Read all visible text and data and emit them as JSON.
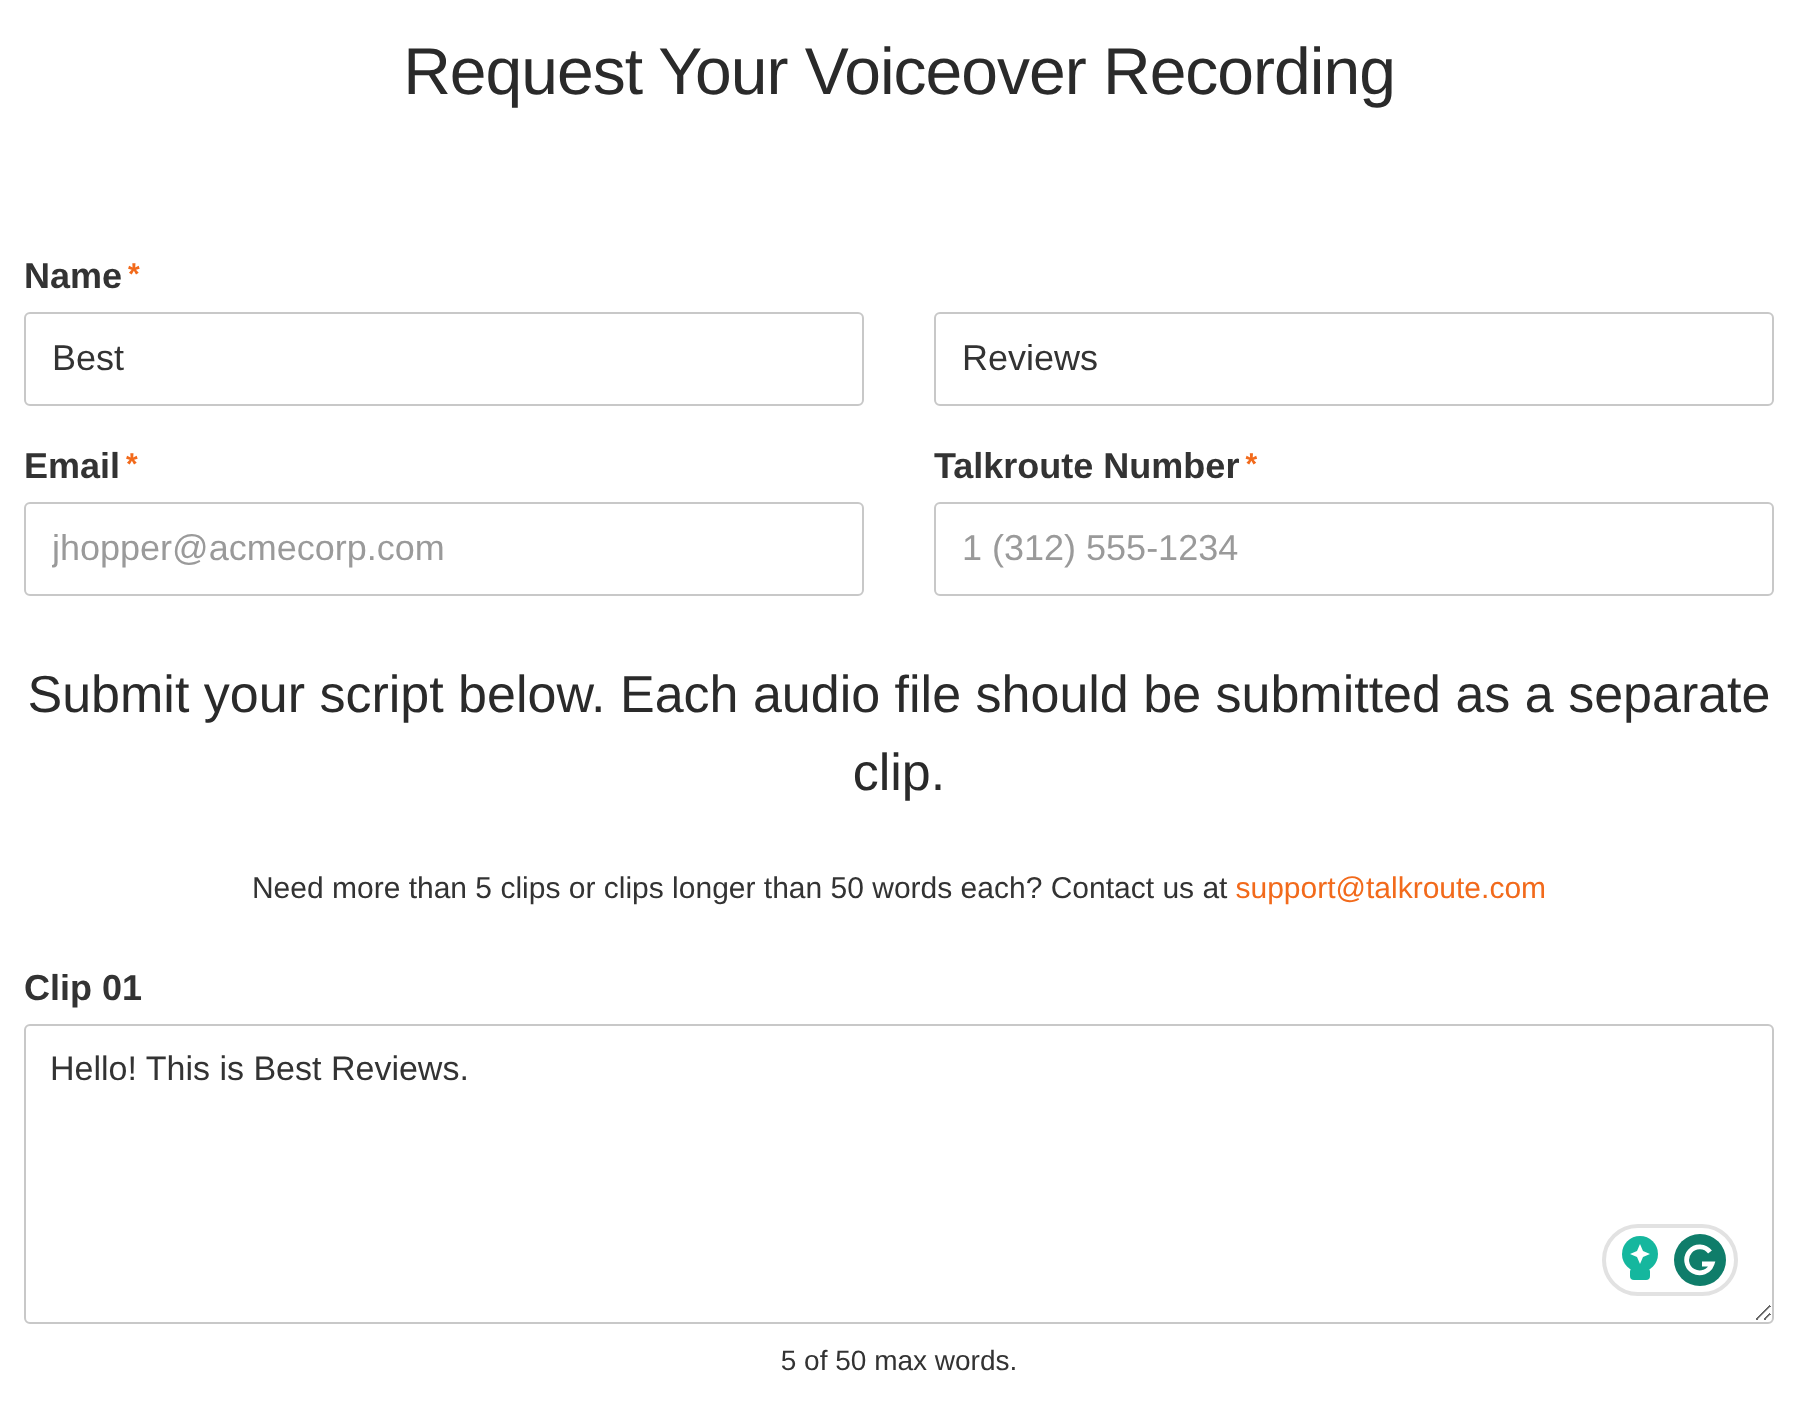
{
  "title": "Request Your Voiceover Recording",
  "rows": [
    {
      "fields": [
        {
          "label": "Name",
          "required_mark": "*",
          "value": "Best"
        },
        {
          "value": "Reviews"
        }
      ]
    },
    {
      "fields": [
        {
          "label": "Email",
          "required_mark": "*",
          "placeholder": "jhopper@acmecorp.com"
        },
        {
          "label": "Talkroute Number",
          "required_mark": "*",
          "placeholder": "1 (312) 555-1234"
        }
      ]
    }
  ],
  "instructions": "Submit your script below. Each audio file should be submitted as a separate clip.",
  "note": {
    "text": "Need more than 5 clips or clips longer than 50 words each? Contact us at",
    "link": "support@talkroute.com"
  },
  "clips": [
    {
      "label": "Clip 01",
      "value": "Hello! This is Best Reviews.",
      "word_count": "5 of 50 max words."
    }
  ]
}
